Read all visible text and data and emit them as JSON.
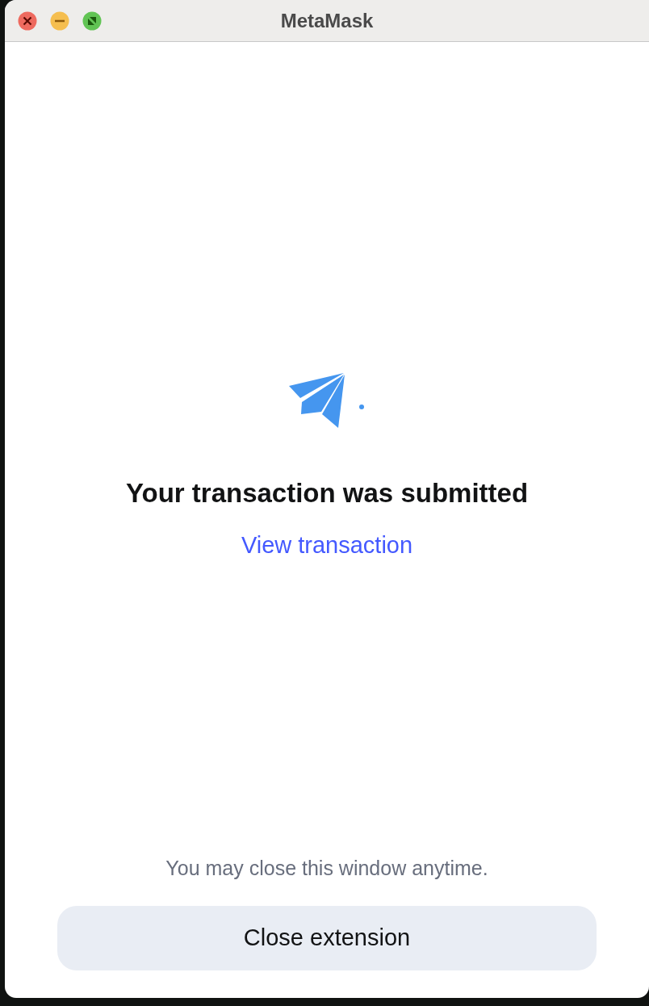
{
  "window": {
    "title": "MetaMask"
  },
  "status": {
    "heading": "Your transaction was submitted",
    "link": "View transaction"
  },
  "footer": {
    "note": "You may close this window anytime.",
    "button": "Close extension"
  }
}
